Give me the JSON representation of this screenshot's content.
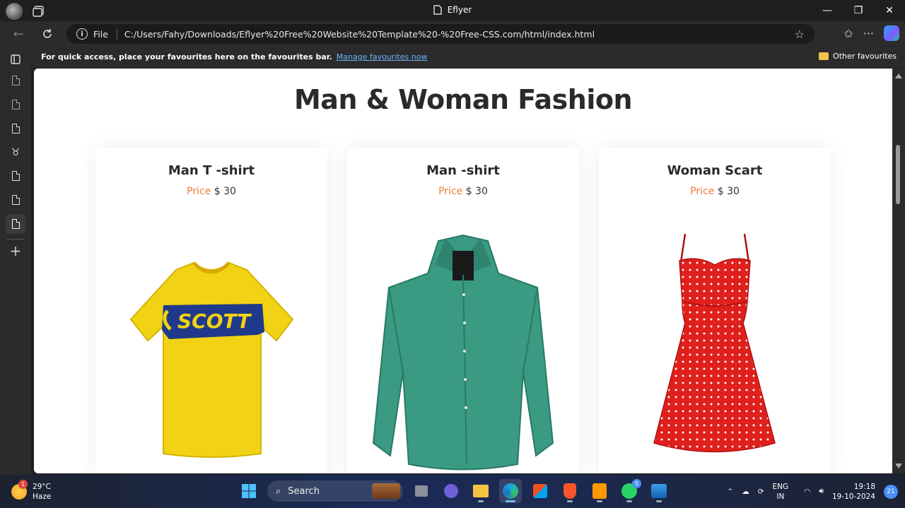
{
  "window": {
    "title": "Eflyer"
  },
  "addressbar": {
    "protocol_label": "File",
    "url": "C:/Users/Fahy/Downloads/Eflyer%20Free%20Website%20Template%20-%20Free-CSS.com/html/index.html"
  },
  "favbar": {
    "message": "For quick access, place your favourites here on the favourites bar.",
    "link": "Manage favourites now",
    "other": "Other favourites"
  },
  "page": {
    "heading": "Man & Woman Fashion",
    "price_label": "Price",
    "products": [
      {
        "name": "Man T -shirt",
        "price": "$ 30"
      },
      {
        "name": "Man -shirt",
        "price": "$ 30"
      },
      {
        "name": "Woman Scart",
        "price": "$ 30"
      }
    ]
  },
  "taskbar": {
    "weather_temp": "29°C",
    "weather_desc": "Haze",
    "weather_badge": "1",
    "search_label": "Search",
    "whatsapp_badge": "5",
    "lang_top": "ENG",
    "lang_bottom": "IN",
    "time": "19:18",
    "date": "19-10-2024",
    "notifications": "21"
  },
  "colors": {
    "accent_price": "#f07a3a",
    "heading": "#2a2a2a"
  }
}
